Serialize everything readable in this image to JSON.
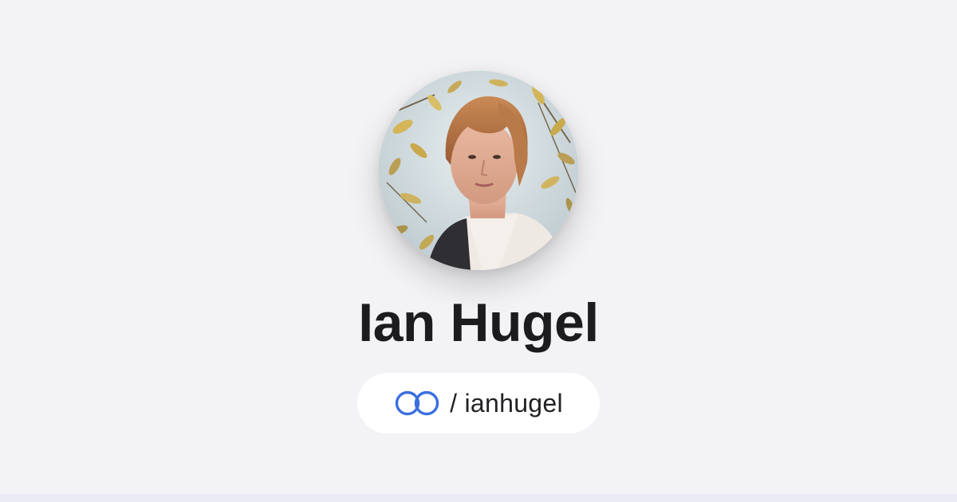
{
  "profile": {
    "name": "Ian Hugel",
    "handle": "/ ianhugel",
    "avatar_alt": "profile photo"
  },
  "icons": {
    "brand_logo": "linked-rings-icon"
  },
  "colors": {
    "background": "#f3f3f6",
    "pill": "#ffffff",
    "accent": "#3b6fe0",
    "name_text": "#1c1c1f",
    "bottom_strip": "#ebebf6"
  }
}
